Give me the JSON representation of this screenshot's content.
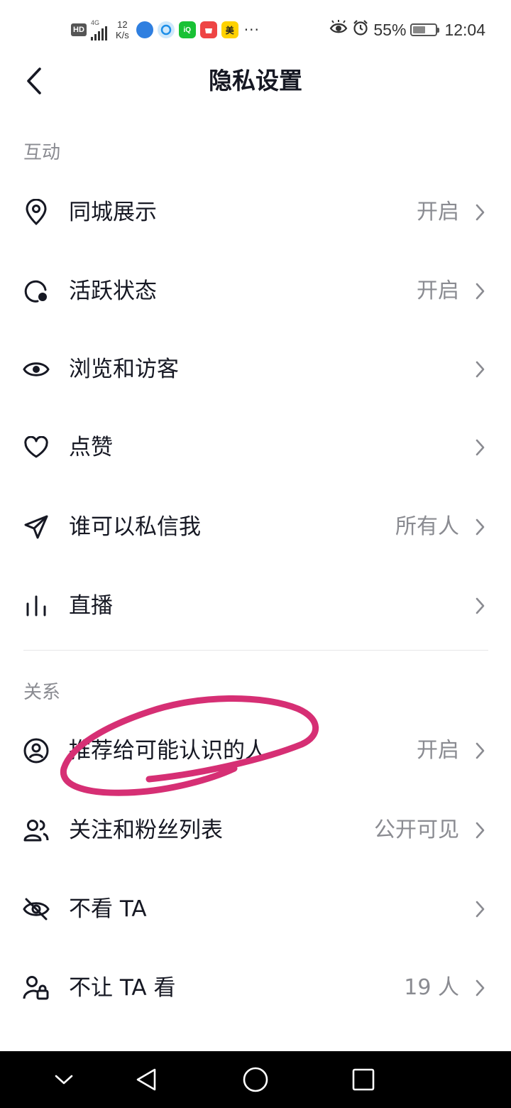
{
  "status_bar": {
    "hd": "HD",
    "network": "4G",
    "network_sub": "1ı",
    "speed_value": "12",
    "speed_unit": "K/s",
    "more": "···",
    "meituan_icon_text": "美",
    "battery_percent": "55%",
    "battery_level": 0.55,
    "time": "12:04",
    "icons": [
      "hd-icon",
      "signal-icon",
      "app-notify-icon",
      "qq-browser-icon",
      "iqiyi-icon",
      "huawei-store-icon",
      "meituan-icon",
      "eye-comfort-icon",
      "alarm-icon",
      "battery-icon"
    ]
  },
  "header": {
    "title": "隐私设置"
  },
  "sections": {
    "interaction": {
      "title": "互动",
      "items": [
        {
          "label": "同城展示",
          "value": "开启",
          "icon": "location-icon"
        },
        {
          "label": "活跃状态",
          "value": "开启",
          "icon": "active-status-icon"
        },
        {
          "label": "浏览和访客",
          "value": "",
          "icon": "eye-icon"
        },
        {
          "label": "点赞",
          "value": "",
          "icon": "heart-icon"
        },
        {
          "label": "谁可以私信我",
          "value": "所有人",
          "icon": "send-icon"
        },
        {
          "label": "直播",
          "value": "",
          "icon": "live-bars-icon"
        }
      ]
    },
    "relationship": {
      "title": "关系",
      "items": [
        {
          "label": "推荐给可能认识的人",
          "value": "开启",
          "icon": "user-circle-icon"
        },
        {
          "label": "关注和粉丝列表",
          "value": "公开可见",
          "icon": "users-icon"
        },
        {
          "label": "不看 TA",
          "value": "",
          "icon": "eye-off-icon"
        },
        {
          "label": "不让 TA 看",
          "value": "19 人",
          "icon": "user-lock-icon"
        }
      ]
    }
  },
  "colors": {
    "text_primary": "#161823",
    "text_secondary": "#8a8b91",
    "annotation": "#d62f74"
  }
}
